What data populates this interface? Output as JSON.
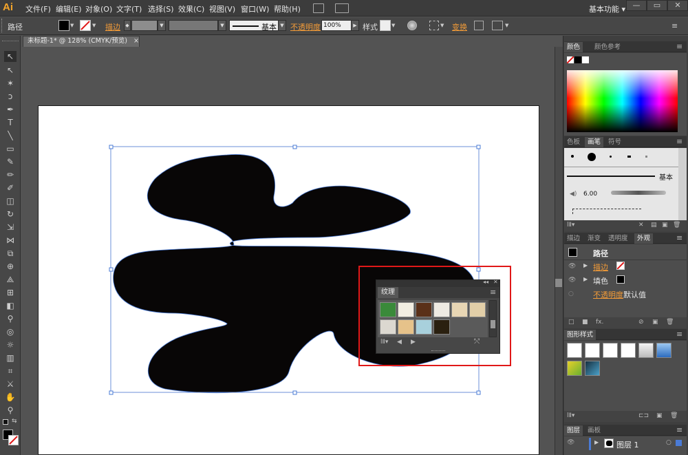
{
  "app": {
    "logo": "Ai"
  },
  "menu": [
    "文件(F)",
    "编辑(E)",
    "对象(O)",
    "文字(T)",
    "选择(S)",
    "效果(C)",
    "视图(V)",
    "窗口(W)",
    "帮助(H)"
  ],
  "workspace": {
    "label": "基本功能",
    "arrow": "▾"
  },
  "window_buttons": {
    "minimize": "—",
    "restore": "▭",
    "close": "✕"
  },
  "control_bar": {
    "object_type": "路径",
    "stroke_label": "描边",
    "stroke_style": "基本",
    "opacity_label": "不透明度",
    "opacity_value": "100%",
    "style_label": "样式",
    "recolor_label": "变换"
  },
  "document_tab": {
    "title": "未标题-1* @ 128% (CMYK/预览)",
    "close": "×"
  },
  "panels": {
    "color": {
      "tabs": [
        "颜色",
        "颜色参考"
      ],
      "active": 0
    },
    "brushes": {
      "tabs": [
        "色板",
        "画笔",
        "符号"
      ],
      "active": 1,
      "basic_label": "基本",
      "size_value": "6.00"
    },
    "appearance": {
      "tabs": [
        "描边",
        "渐变",
        "透明度",
        "外观"
      ],
      "active": 3,
      "title": "路径",
      "rows": [
        {
          "label": "描边"
        },
        {
          "label": "填色"
        },
        {
          "label": "不透明度",
          "value": "默认值"
        }
      ]
    },
    "graphic_styles": {
      "tabs": [
        "图形样式"
      ],
      "active": 0
    },
    "layers": {
      "tabs": [
        "图层",
        "画板"
      ],
      "active": 0,
      "layer_name": "图层 1"
    }
  },
  "texture_panel": {
    "title": "纹理",
    "swatch_colors": [
      "#3a8a3a",
      "#f2eee2",
      "#5a3018",
      "#eeeae2",
      "#e8d6b4",
      "#e2cfa8",
      "#dcd8d0",
      "#e6c28a",
      "#a8d0dc",
      "#2a2010"
    ]
  },
  "colors": {
    "accent_orange": "#f29b38",
    "highlight_red": "#e01818",
    "selection_blue": "#4a7bd6"
  }
}
